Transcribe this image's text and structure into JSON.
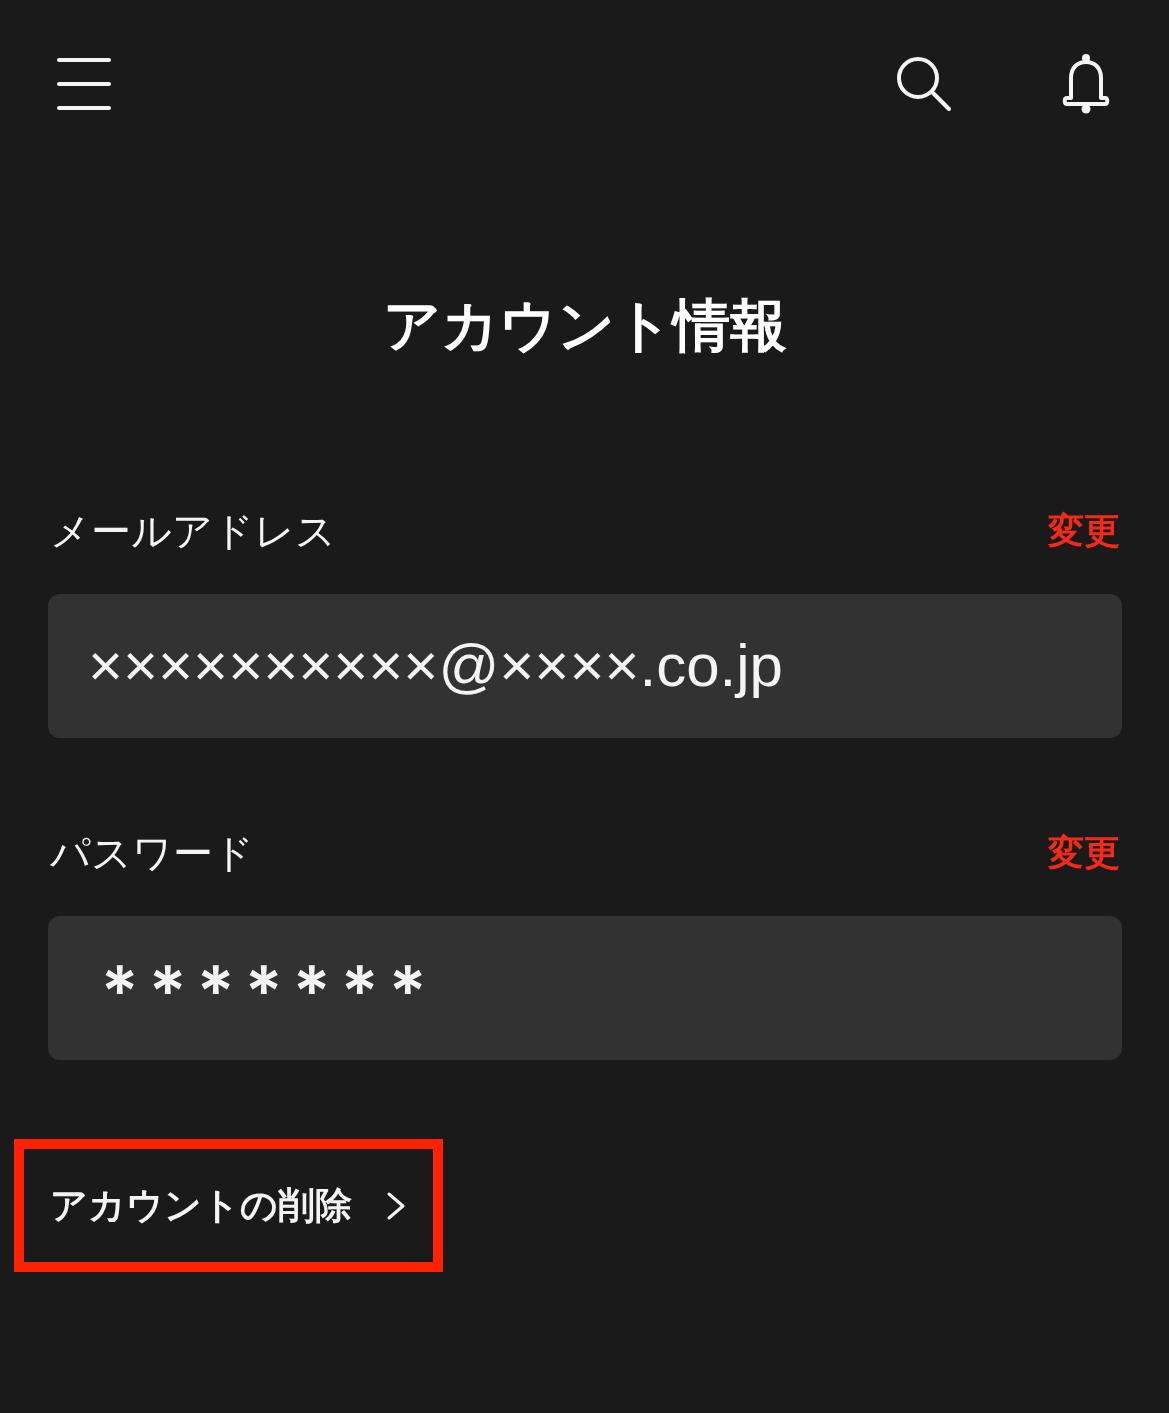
{
  "page": {
    "title": "アカウント情報"
  },
  "fields": [
    {
      "kind": "email",
      "label": "メールアドレス",
      "action": "変更",
      "value": "××××××××××@××××.co.jp"
    },
    {
      "kind": "password",
      "label": "パスワード",
      "action": "変更",
      "value": "＊＊＊＊＊＊＊"
    }
  ],
  "delete_link": {
    "label": "アカウントの削除",
    "highlighted": true
  }
}
